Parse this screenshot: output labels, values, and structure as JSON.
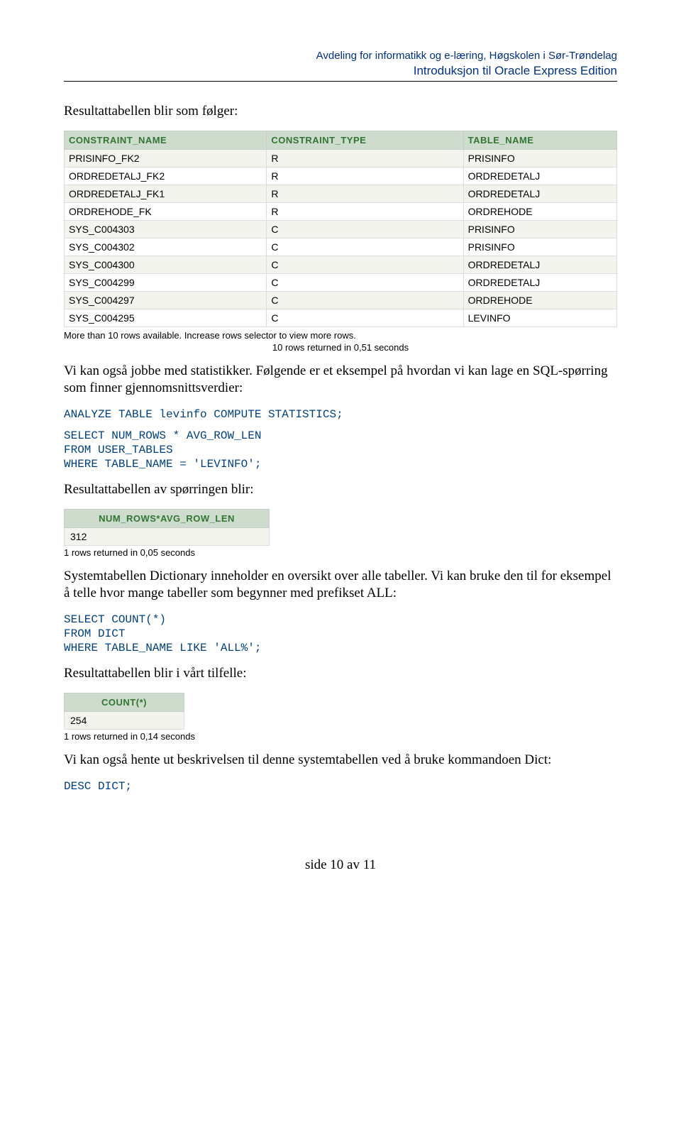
{
  "header": {
    "line1": "Avdeling for informatikk og e-læring, Høgskolen i Sør-Trøndelag",
    "line2": "Introduksjon til Oracle Express Edition"
  },
  "intro": "Resultattabellen blir som følger:",
  "table1": {
    "headers": [
      "CONSTRAINT_NAME",
      "CONSTRAINT_TYPE",
      "TABLE_NAME"
    ],
    "rows": [
      [
        "PRISINFO_FK2",
        "R",
        "PRISINFO"
      ],
      [
        "ORDREDETALJ_FK2",
        "R",
        "ORDREDETALJ"
      ],
      [
        "ORDREDETALJ_FK1",
        "R",
        "ORDREDETALJ"
      ],
      [
        "ORDREHODE_FK",
        "R",
        "ORDREHODE"
      ],
      [
        "SYS_C004303",
        "C",
        "PRISINFO"
      ],
      [
        "SYS_C004302",
        "C",
        "PRISINFO"
      ],
      [
        "SYS_C004300",
        "C",
        "ORDREDETALJ"
      ],
      [
        "SYS_C004299",
        "C",
        "ORDREDETALJ"
      ],
      [
        "SYS_C004297",
        "C",
        "ORDREHODE"
      ],
      [
        "SYS_C004295",
        "C",
        "LEVINFO"
      ]
    ],
    "footer1": "More than 10 rows available. Increase rows selector to view more rows.",
    "footer2": "10 rows returned in 0,51 seconds"
  },
  "para2": "Vi kan også jobbe med statistikker. Følgende er et eksempel på hvordan vi kan lage en SQL-spørring som finner gjennomsnittsverdier:",
  "sql1": "ANALYZE TABLE levinfo COMPUTE STATISTICS;",
  "sql2": "SELECT NUM_ROWS * AVG_ROW_LEN\nFROM USER_TABLES\nWHERE TABLE_NAME = 'LEVINFO';",
  "para3": "Resultattabellen av spørringen blir:",
  "table2": {
    "header": "NUM_ROWS*AVG_ROW_LEN",
    "value": "312",
    "footer": "1 rows returned in 0,05 seconds"
  },
  "para4": "Systemtabellen Dictionary inneholder en oversikt over alle tabeller. Vi kan bruke den til for eksempel å telle hvor mange tabeller som begynner med prefikset ALL:",
  "sql3": "SELECT COUNT(*)\nFROM DICT\nWHERE TABLE_NAME LIKE 'ALL%';",
  "para5": "Resultattabellen blir i vårt tilfelle:",
  "table3": {
    "header": "COUNT(*)",
    "value": "254",
    "footer": "1 rows returned in 0,14 seconds"
  },
  "para6": "Vi kan også hente ut beskrivelsen til denne systemtabellen ved å bruke kommandoen Dict:",
  "sql4": "DESC DICT;",
  "pageFooter": "side 10 av 11"
}
